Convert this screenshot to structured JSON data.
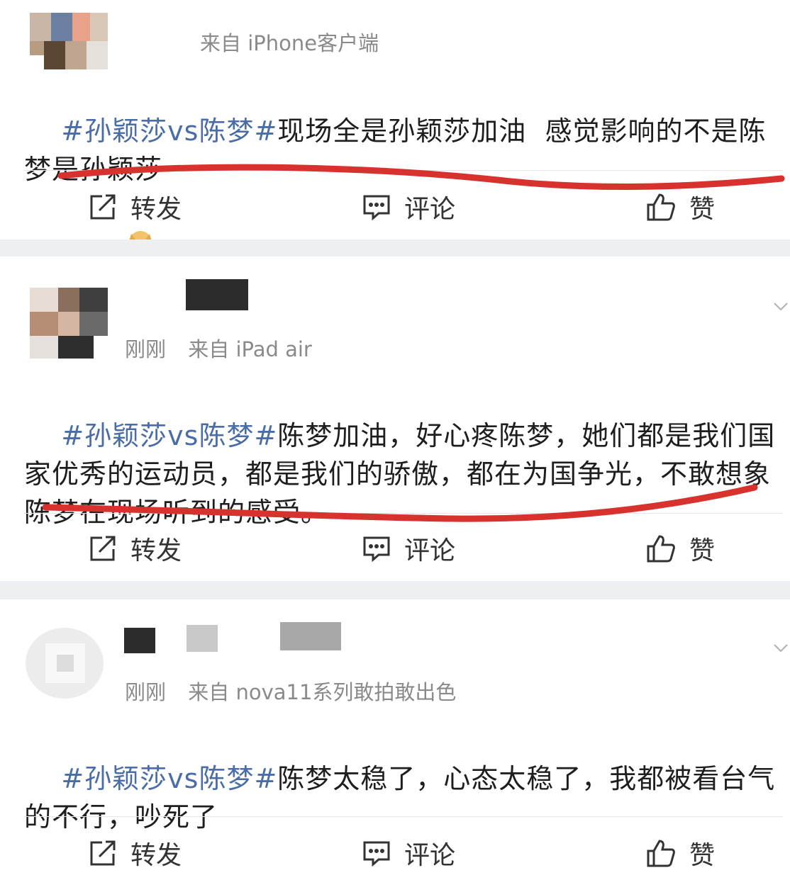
{
  "posts": [
    {
      "time": "",
      "source": "来自 iPhone客户端",
      "hashtag": "#孙颖莎vs陈梦#",
      "body": "现场全是孙颖莎加油  感觉影响的不是陈梦是孙颖莎",
      "emoji": "doge-emoji"
    },
    {
      "time": "刚刚",
      "source": "来自 iPad air",
      "hashtag": "#孙颖莎vs陈梦#",
      "body": "陈梦加油，好心疼陈梦，她们都是我们国家优秀的运动员，都是我们的骄傲，都在为国争光，不敢想象陈梦在现场听到的感受。"
    },
    {
      "time": "刚刚",
      "source": "来自 nova11系列敢拍敢出色",
      "hashtag": "#孙颖莎vs陈梦#",
      "body": "陈梦太稳了，心态太稳了，我都被看台气的不行，吵死了"
    }
  ],
  "actions": {
    "repost": "转发",
    "comment": "评论",
    "like": "赞"
  },
  "colors": {
    "hashtag": "#4a6da7",
    "underline": "#d8322f",
    "separator": "#eeeff2"
  },
  "icons": [
    "repost-icon",
    "comment-icon",
    "like-icon",
    "chevron-down-icon",
    "doge-emoji"
  ]
}
